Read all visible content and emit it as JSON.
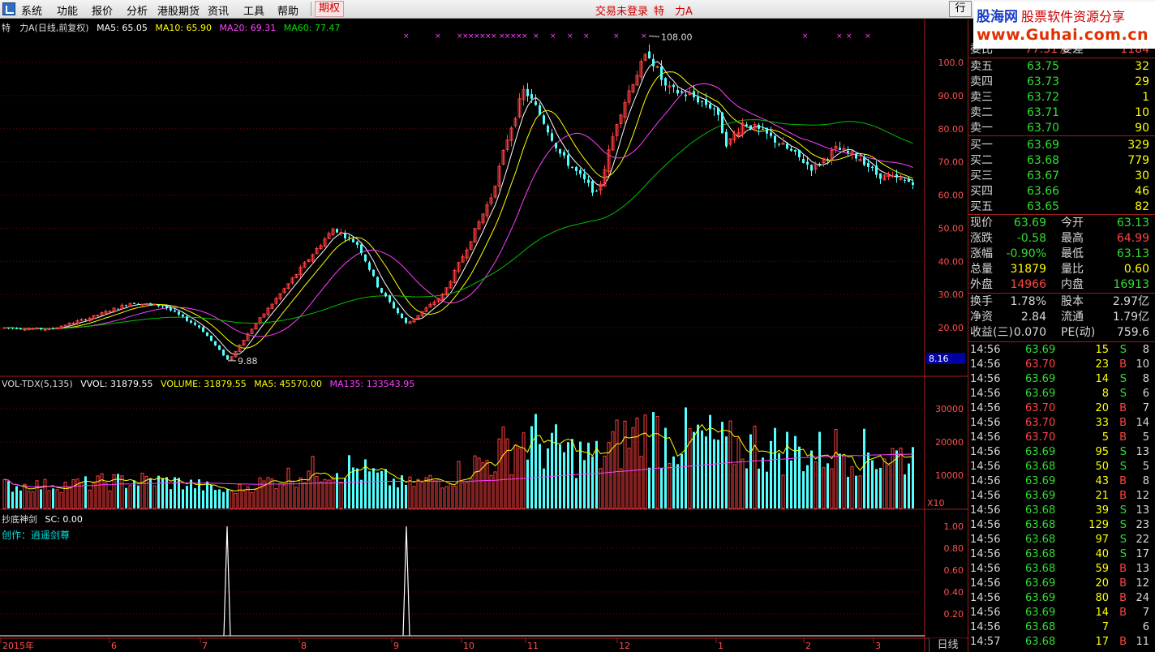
{
  "menu": {
    "items": [
      "系统",
      "功能",
      "报价",
      "分析",
      "港股期货",
      "资讯",
      "工具",
      "帮助",
      "期权"
    ],
    "login_status": "交易未登录",
    "stock_title": "特　力A",
    "trade_button": "行"
  },
  "watermark": {
    "line1_brand": "股海网",
    "line1_sub": "股票软件资源分享",
    "line2": "www.Guhai.com.cn"
  },
  "main_chart": {
    "header_name": "特　力A(日线,前复权)",
    "ma5": "MA5: 65.05",
    "ma10": "MA10: 65.90",
    "ma20": "MA20: 69.31",
    "ma60": "MA60: 77.47",
    "y_ticks": [
      "100.0",
      "90.00",
      "80.00",
      "70.00",
      "60.00",
      "50.00",
      "40.00",
      "30.00",
      "20.00"
    ],
    "high_label": "108.00",
    "low_label": "9.88",
    "cursor_value": "8.16"
  },
  "volume_chart": {
    "name": "VOL-TDX(5,135)",
    "vvol": "VVOL: 31879.55",
    "volume": "VOLUME: 31879.55",
    "ma5": "MA5: 45570.00",
    "ma135": "MA135: 133543.95",
    "y_ticks": [
      "30000",
      "20000",
      "10000"
    ],
    "unit": "X10"
  },
  "indicator": {
    "name": "抄底神剑",
    "sc": "SC: 0.00",
    "author": "创作：逍遥剑尊",
    "y_ticks": [
      "1.00",
      "0.80",
      "0.60",
      "0.40",
      "0.20"
    ]
  },
  "x_axis": [
    "2015年",
    "6",
    "7",
    "8",
    "9",
    "10",
    "11",
    "12",
    "1",
    "2",
    "3"
  ],
  "period": "日线",
  "colors": {
    "up": "#ff4040",
    "down": "#54ffff",
    "ma5": "#ffffff",
    "ma10": "#ffff00",
    "ma20": "#ff40ff",
    "ma60": "#00c000",
    "grid": "#8b0000"
  },
  "order_book": {
    "ratio_label": "委比",
    "ratio_value": "77.31%",
    "diff_label": "委差",
    "diff_value": "1184",
    "asks": [
      {
        "label": "卖五",
        "price": "63.75",
        "vol": "32"
      },
      {
        "label": "卖四",
        "price": "63.73",
        "vol": "29"
      },
      {
        "label": "卖三",
        "price": "63.72",
        "vol": "1"
      },
      {
        "label": "卖二",
        "price": "63.71",
        "vol": "10"
      },
      {
        "label": "卖一",
        "price": "63.70",
        "vol": "90"
      }
    ],
    "bids": [
      {
        "label": "买一",
        "price": "63.69",
        "vol": "329"
      },
      {
        "label": "买二",
        "price": "63.68",
        "vol": "779"
      },
      {
        "label": "买三",
        "price": "63.67",
        "vol": "30"
      },
      {
        "label": "买四",
        "price": "63.66",
        "vol": "46"
      },
      {
        "label": "买五",
        "price": "63.65",
        "vol": "82"
      }
    ]
  },
  "quote": [
    {
      "l1": "现价",
      "v1": "63.69",
      "c1": "g",
      "l2": "今开",
      "v2": "63.13",
      "c2": "g"
    },
    {
      "l1": "涨跌",
      "v1": "-0.58",
      "c1": "g",
      "l2": "最高",
      "v2": "64.99",
      "c2": "r"
    },
    {
      "l1": "涨幅",
      "v1": "-0.90%",
      "c1": "g",
      "l2": "最低",
      "v2": "63.13",
      "c2": "g"
    },
    {
      "l1": "总量",
      "v1": "31879",
      "c1": "y",
      "l2": "量比",
      "v2": "0.60",
      "c2": "y"
    },
    {
      "l1": "外盘",
      "v1": "14966",
      "c1": "r",
      "l2": "内盘",
      "v2": "16913",
      "c2": "g"
    }
  ],
  "fundamentals": [
    {
      "l1": "换手",
      "v1": "1.78%",
      "l2": "股本",
      "v2": "2.97亿"
    },
    {
      "l1": "净资",
      "v1": "2.84",
      "l2": "流通",
      "v2": "1.79亿"
    },
    {
      "l1": "收益(三)",
      "v1": "0.070",
      "l2": "PE(动)",
      "v2": "759.6"
    }
  ],
  "ticks": [
    {
      "t": "14:56",
      "p": "63.69",
      "v": "15",
      "s": "S",
      "n": "8"
    },
    {
      "t": "14:56",
      "p": "63.70",
      "v": "23",
      "s": "B",
      "n": "10"
    },
    {
      "t": "14:56",
      "p": "63.69",
      "v": "14",
      "s": "S",
      "n": "8"
    },
    {
      "t": "14:56",
      "p": "63.69",
      "v": "8",
      "s": "S",
      "n": "6"
    },
    {
      "t": "14:56",
      "p": "63.70",
      "v": "20",
      "s": "B",
      "n": "7"
    },
    {
      "t": "14:56",
      "p": "63.70",
      "v": "33",
      "s": "B",
      "n": "14"
    },
    {
      "t": "14:56",
      "p": "63.70",
      "v": "5",
      "s": "B",
      "n": "5"
    },
    {
      "t": "14:56",
      "p": "63.69",
      "v": "95",
      "s": "S",
      "n": "13"
    },
    {
      "t": "14:56",
      "p": "63.68",
      "v": "50",
      "s": "S",
      "n": "5"
    },
    {
      "t": "14:56",
      "p": "63.69",
      "v": "43",
      "s": "B",
      "n": "8"
    },
    {
      "t": "14:56",
      "p": "63.69",
      "v": "21",
      "s": "B",
      "n": "12"
    },
    {
      "t": "14:56",
      "p": "63.68",
      "v": "39",
      "s": "S",
      "n": "13"
    },
    {
      "t": "14:56",
      "p": "63.68",
      "v": "129",
      "s": "S",
      "n": "23"
    },
    {
      "t": "14:56",
      "p": "63.68",
      "v": "97",
      "s": "S",
      "n": "22"
    },
    {
      "t": "14:56",
      "p": "63.68",
      "v": "40",
      "s": "S",
      "n": "17"
    },
    {
      "t": "14:56",
      "p": "63.68",
      "v": "59",
      "s": "B",
      "n": "13"
    },
    {
      "t": "14:56",
      "p": "63.69",
      "v": "20",
      "s": "B",
      "n": "12"
    },
    {
      "t": "14:56",
      "p": "63.69",
      "v": "80",
      "s": "B",
      "n": "24"
    },
    {
      "t": "14:56",
      "p": "63.69",
      "v": "14",
      "s": "B",
      "n": "7"
    },
    {
      "t": "14:56",
      "p": "63.68",
      "v": "7",
      "s": "",
      "n": "6"
    },
    {
      "t": "14:57",
      "p": "63.68",
      "v": "17",
      "s": "B",
      "n": "11"
    }
  ]
}
